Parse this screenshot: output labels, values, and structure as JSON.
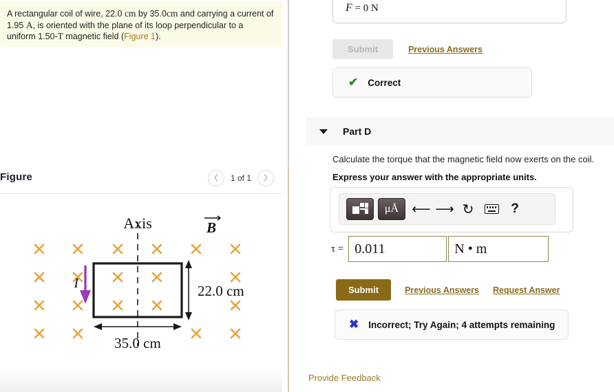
{
  "problem": {
    "text_part1": "A rectangular coil of wire, 22.0",
    "unit_cm_1": "cm",
    "text_part2": "by 35.0",
    "unit_cm_2": "cm",
    "text_part3": "and carrying a current of 1.95",
    "unit_A": "A",
    "text_part4": ", is oriented with the plane of its loop perpendicular to a uniform 1.50-",
    "unit_T": "T",
    "text_part5": "magnetic field (",
    "figure_link": "Figure 1",
    "text_part6": ")."
  },
  "figure": {
    "title": "Figure",
    "counter": "1 of 1",
    "prev_icon": "chevron-left-icon",
    "next_icon": "chevron-right-icon",
    "diagram": {
      "axis_label": "Axis",
      "field_label": "B",
      "field_symbol": "×",
      "field_color": "#e8a33d",
      "current_label": "I",
      "current_color": "#9b3fb5",
      "height_label": "22.0 cm",
      "width_label": "35.0 cm",
      "coil_color": "#1a1a1a"
    }
  },
  "previous_part": {
    "answer_symbol": "F",
    "answer_equals": "=",
    "answer_value": "0 N",
    "submit_label": "Submit",
    "previous_answers_label": "Previous Answers",
    "status_icon": "check-icon",
    "status_text": "Correct"
  },
  "part_d": {
    "caret_icon": "caret-down-icon",
    "title": "Part D",
    "question": "Calculate the torque that the magnetic field now exerts on the coil.",
    "instruction": "Express your answer with the appropriate units.",
    "toolbar": {
      "template_icon": "math-template-icon",
      "units_icon": "units-palette-icon",
      "units_label": "μÅ",
      "undo_icon": "undo-icon",
      "undo_glyph": "←",
      "redo_icon": "redo-icon",
      "redo_glyph": "→",
      "reset_icon": "reset-icon",
      "reset_glyph": "↻",
      "keyboard_icon": "keyboard-icon",
      "help_icon": "help-icon",
      "help_glyph": "?"
    },
    "answer": {
      "symbol": "τ",
      "equals": "=",
      "value": "0.011",
      "unit": "N • m"
    },
    "submit_label": "Submit",
    "previous_answers_label": "Previous Answers",
    "request_answer_label": "Request Answer",
    "status_icon": "x-icon",
    "status_text": "Incorrect; Try Again; 4 attempts remaining"
  },
  "footer": {
    "provide_feedback_label": "Provide Feedback"
  }
}
